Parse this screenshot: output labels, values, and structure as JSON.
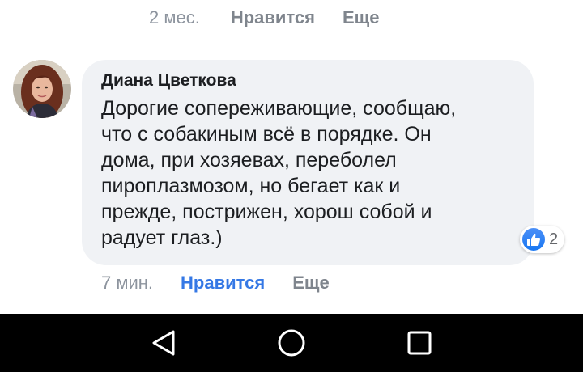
{
  "previous_comment": {
    "time": "2 мес.",
    "like_label": "Нравится",
    "more_label": "Еще"
  },
  "comment": {
    "author": "Диана Цветкова",
    "text": "Дорогие сопереживающие, сообщаю,\nчто с собакиным всё в порядке. Он\nдома, при хозяевах, переболел\nпироплазмозом, но бегает как и\nпрежде, пострижен, хорош собой и\nрадует глаз.)",
    "reaction_icon": "thumbs-up-icon",
    "reaction_count": "2",
    "time": "7 мин.",
    "like_label": "Нравится",
    "more_label": "Еще"
  },
  "colors": {
    "bubble": "#f0f2f5",
    "like_active": "#3578e5",
    "muted": "#8d949e",
    "navbar": "#000000"
  },
  "navbar": {
    "icons": [
      "back-icon",
      "home-icon",
      "recents-icon"
    ]
  }
}
